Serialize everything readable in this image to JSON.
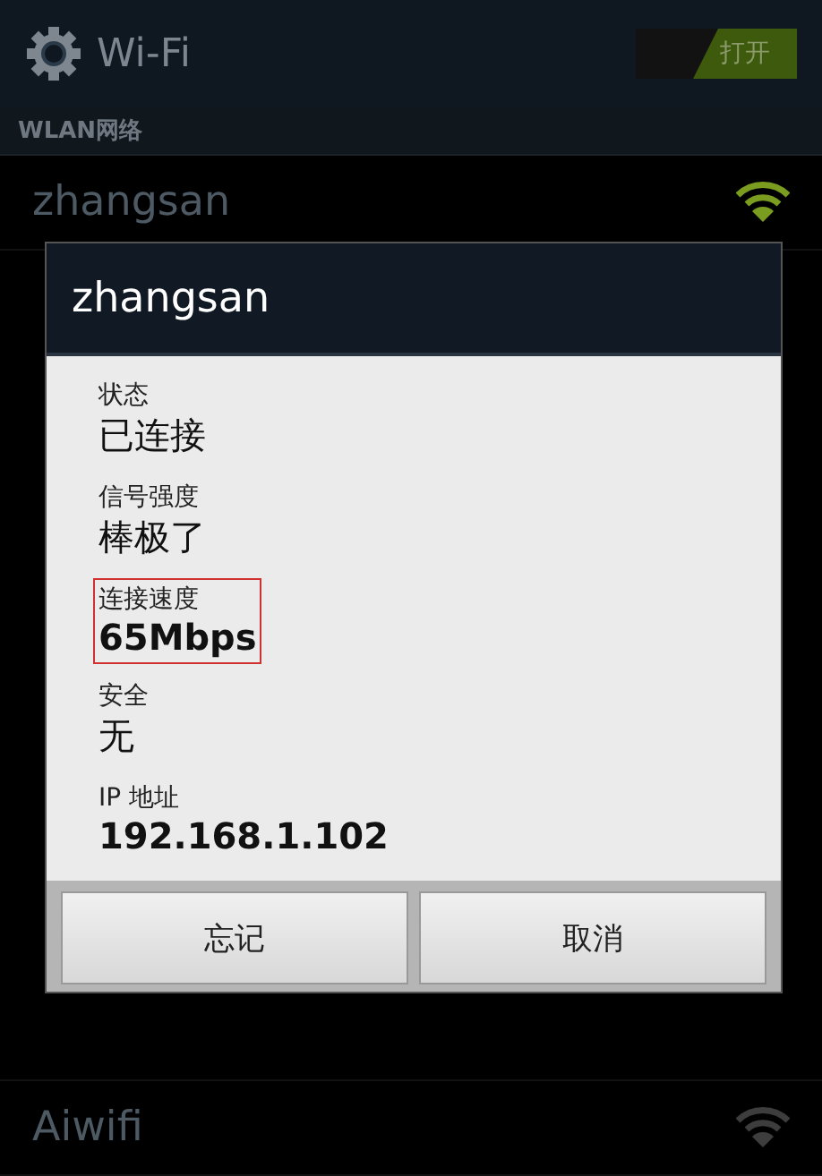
{
  "action_bar": {
    "title": "Wi-Fi",
    "toggle": {
      "label": "打开",
      "on": true
    }
  },
  "section_header": "WLAN网络",
  "networks": [
    {
      "name": "zhangsan",
      "connected": true
    },
    {
      "name": "Aiwifi",
      "connected": false
    }
  ],
  "dialog": {
    "title": "zhangsan",
    "fields": [
      {
        "label": "状态",
        "value": "已连接",
        "bold": false,
        "highlighted": false
      },
      {
        "label": "信号强度",
        "value": "棒极了",
        "bold": false,
        "highlighted": false
      },
      {
        "label": "连接速度",
        "value": "65Mbps",
        "bold": true,
        "highlighted": true
      },
      {
        "label": "安全",
        "value": "无",
        "bold": false,
        "highlighted": false
      },
      {
        "label": "IP 地址",
        "value": "192.168.1.102",
        "bold": true,
        "highlighted": false
      }
    ],
    "buttons": [
      "忘记",
      "取消"
    ]
  }
}
